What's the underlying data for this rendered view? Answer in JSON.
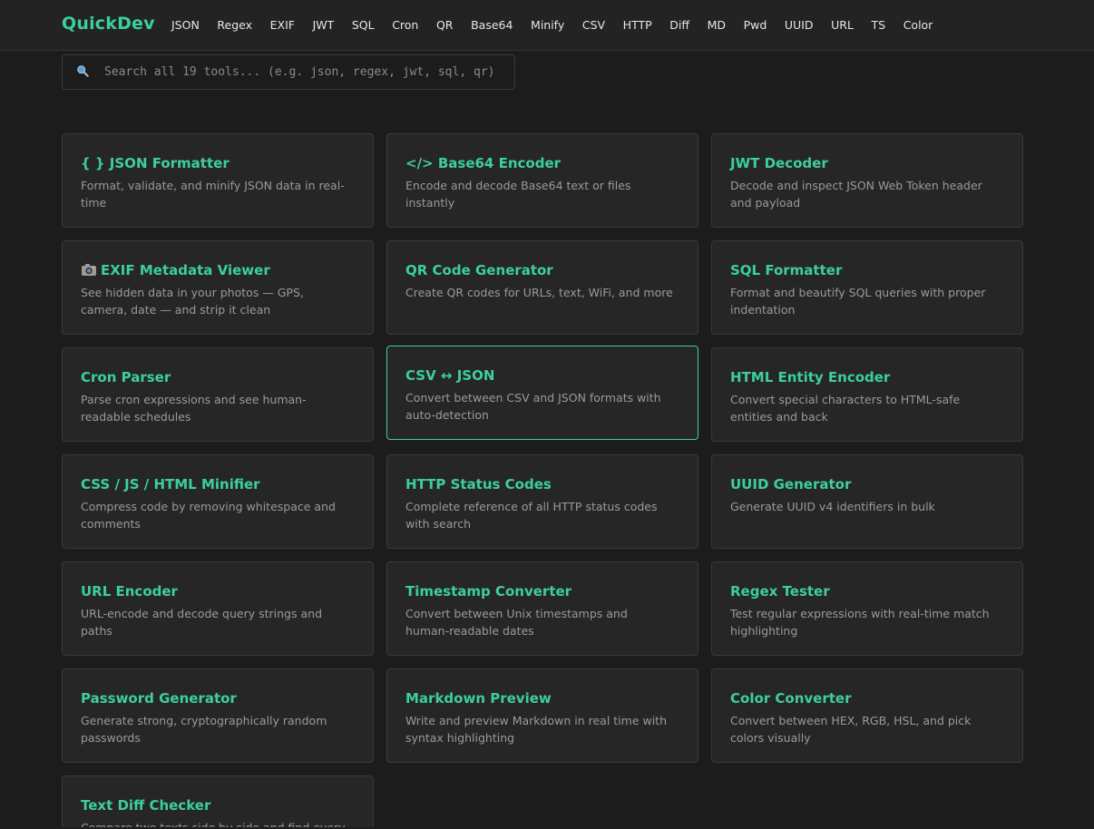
{
  "brand": {
    "name": "QuickDev",
    "accent": "#3ccf9e"
  },
  "nav": [
    "JSON",
    "Regex",
    "EXIF",
    "JWT",
    "SQL",
    "Cron",
    "QR",
    "Base64",
    "Minify",
    "CSV",
    "HTTP",
    "Diff",
    "MD",
    "Pwd",
    "UUID",
    "URL",
    "TS",
    "Color"
  ],
  "search": {
    "icon": "search-icon",
    "placeholder": "Search all 19 tools... (e.g. json, regex, jwt, sql, qr)",
    "value": ""
  },
  "tools": [
    {
      "title": "{ } JSON Formatter",
      "desc": "Format, validate, and minify JSON data in real-time"
    },
    {
      "title": "</> Base64 Encoder",
      "desc": "Encode and decode Base64 text or files instantly"
    },
    {
      "title": "JWT Decoder",
      "desc": "Decode and inspect JSON Web Token header and payload"
    },
    {
      "title": "EXIF Metadata Viewer",
      "icon": "camera-icon",
      "desc": "See hidden data in your photos — GPS, camera, date — and strip it clean"
    },
    {
      "title": "QR Code Generator",
      "desc": "Create QR codes for URLs, text, WiFi, and more"
    },
    {
      "title": "SQL Formatter",
      "desc": "Format and beautify SQL queries with proper indentation"
    },
    {
      "title": "Cron Parser",
      "desc": "Parse cron expressions and see human-readable schedules"
    },
    {
      "title": "CSV ↔ JSON",
      "desc": "Convert between CSV and JSON formats with auto-detection",
      "active": true
    },
    {
      "title": "HTML Entity Encoder",
      "desc": "Convert special characters to HTML-safe entities and back"
    },
    {
      "title": "CSS / JS / HTML Minifier",
      "desc": "Compress code by removing whitespace and comments"
    },
    {
      "title": "HTTP Status Codes",
      "desc": "Complete reference of all HTTP status codes with search"
    },
    {
      "title": "UUID Generator",
      "desc": "Generate UUID v4 identifiers in bulk"
    },
    {
      "title": "URL Encoder",
      "desc": "URL-encode and decode query strings and paths"
    },
    {
      "title": "Timestamp Converter",
      "desc": "Convert between Unix timestamps and human-readable dates"
    },
    {
      "title": "Regex Tester",
      "desc": "Test regular expressions with real-time match highlighting"
    },
    {
      "title": "Password Generator",
      "desc": "Generate strong, cryptographically random passwords"
    },
    {
      "title": "Markdown Preview",
      "desc": "Write and preview Markdown in real time with syntax highlighting"
    },
    {
      "title": "Color Converter",
      "desc": "Convert between HEX, RGB, HSL, and pick colors visually"
    },
    {
      "title": "Text Diff Checker",
      "desc": "Compare two texts side by side and find every"
    }
  ]
}
